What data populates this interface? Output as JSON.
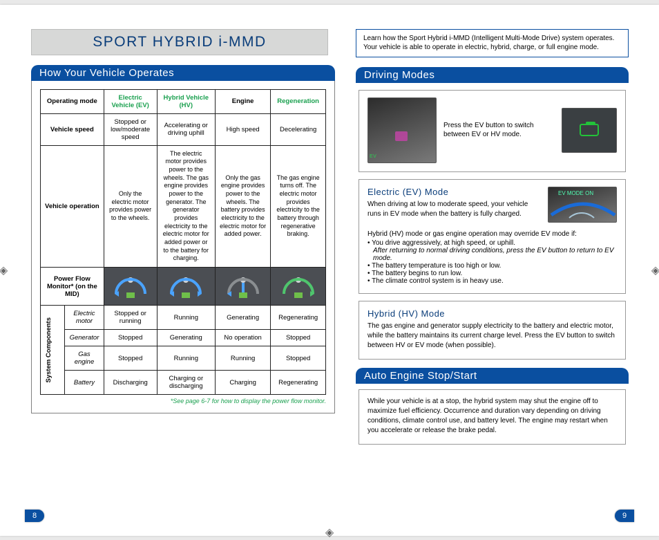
{
  "title": "SPORT HYBRID i-MMD",
  "intro": "Learn how the Sport Hybrid i-MMD (Intelligent Multi-Mode Drive) system operates. Your vehicle is able to operate in electric, hybrid, charge, or full engine mode.",
  "left": {
    "heading": "How Your Vehicle Operates",
    "table": {
      "head": [
        "Operating mode",
        "Electric Vehicle (EV)",
        "Hybrid Vehicle (HV)",
        "Engine",
        "Regeneration"
      ],
      "speed_label": "Vehicle speed",
      "speed": [
        "Stopped or low/moderate speed",
        "Accelerating or driving uphill",
        "High speed",
        "Decelerating"
      ],
      "op_label": "Vehicle operation",
      "op": [
        "Only the electric motor provides power to the wheels.",
        "The electric motor provides power to the wheels. The gas engine provides power to the generator. The generator provides electricity to the electric motor for added power or to the battery for charging.",
        "Only the gas engine provides power to the wheels. The battery provides electricity to the electric motor for added power.",
        "The gas engine turns off. The electric motor provides electricity to the battery through regenerative braking."
      ],
      "pf_label": "Power Flow Monitor* (on the MID)",
      "syslabel": "System Components",
      "rows": [
        {
          "name": "Electric motor",
          "vals": [
            "Stopped or running",
            "Running",
            "Generating",
            "Regenerating"
          ]
        },
        {
          "name": "Generator",
          "vals": [
            "Stopped",
            "Generating",
            "No operation",
            "Stopped"
          ]
        },
        {
          "name": "Gas engine",
          "vals": [
            "Stopped",
            "Running",
            "Running",
            "Stopped"
          ]
        },
        {
          "name": "Battery",
          "vals": [
            "Discharging",
            "Charging or discharging",
            "Charging",
            "Regenerating"
          ]
        }
      ]
    },
    "footnote": "*See page 6-7 for how to display the power flow monitor."
  },
  "right": {
    "driving_heading": "Driving Modes",
    "press_ev": "Press the EV button to switch between EV or HV mode.",
    "ev": {
      "title": "Electric (EV) Mode",
      "body": "When driving at low to moderate speed, your vehicle runs in EV mode when the battery is fully charged.",
      "indicator_text": "EV MODE ON",
      "override_intro": "Hybrid (HV) mode or gas engine operation may override EV mode if:",
      "bullets": [
        "You drive aggressively, at high speed, or uphill.",
        "The battery temperature is too high or low.",
        "The battery begins to run low.",
        "The climate control system is in heavy use."
      ],
      "italic_note": "After returning to normal driving conditions, press the EV button to return to EV mode."
    },
    "hv": {
      "title": "Hybrid (HV) Mode",
      "body": "The gas engine and generator supply electricity to the battery and electric motor, while the battery maintains its current charge level. Press the EV button to switch between HV or EV mode (when possible)."
    },
    "auto_heading": "Auto Engine Stop/Start",
    "auto_body": "While your vehicle is at a stop, the hybrid system may shut the engine off to maximize fuel efficiency. Occurrence and duration vary depending on driving conditions, climate control use, and battery level. The engine may restart when you accelerate or release the brake pedal."
  },
  "pages": {
    "left": "8",
    "right": "9"
  }
}
